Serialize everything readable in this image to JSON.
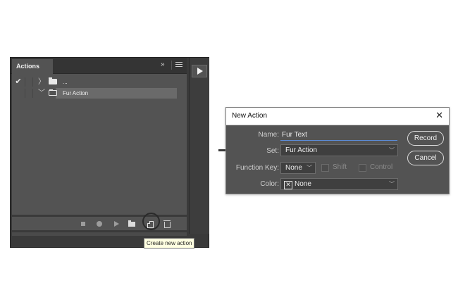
{
  "actions_panel": {
    "tab_label": "Actions",
    "collapse_glyph": "»",
    "rows": [
      {
        "toggle": "✔",
        "twist": "〉",
        "folder": "closed",
        "label": "..."
      },
      {
        "toggle": "",
        "twist": "﹀",
        "folder": "open",
        "label": "Fur Action",
        "selected": true
      }
    ],
    "toolbar_icons": [
      "stop-icon",
      "record-icon",
      "play-icon",
      "new-set-icon",
      "new-action-icon",
      "trash-icon"
    ],
    "tooltip": "Create new action"
  },
  "dialog": {
    "title": "New Action",
    "close_glyph": "✕",
    "name_label": "Name:",
    "name_value": "Fur Text",
    "set_label": "Set:",
    "set_value": "Fur Action",
    "function_key_label": "Function Key:",
    "function_key_value": "None",
    "shift_label": "Shift",
    "control_label": "Control",
    "color_label": "Color:",
    "color_value": "None",
    "color_swatch_glyph": "✕",
    "record_label": "Record",
    "cancel_label": "Cancel"
  },
  "colors": {
    "panel_bg": "#535353",
    "selected_row": "#6a6a6a",
    "name_underline": "#5b8bd6",
    "tooltip_bg": "#ffffe1"
  }
}
